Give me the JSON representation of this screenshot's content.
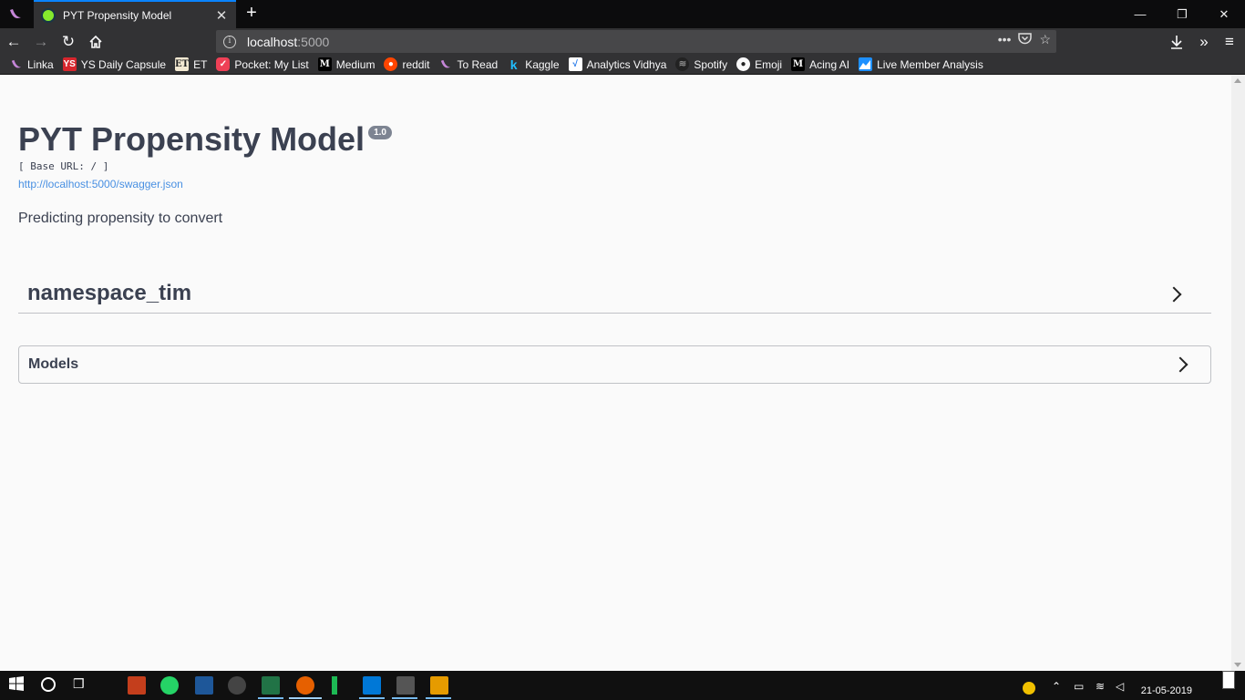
{
  "browser": {
    "tab": {
      "title": "PYT Propensity Model"
    },
    "url": {
      "host": "localhost",
      "port": ":5000"
    },
    "bookmarks": [
      {
        "label": "Linka",
        "icon": "linka-icon"
      },
      {
        "label": "YS Daily Capsule",
        "icon": "ys-icon"
      },
      {
        "label": "ET",
        "icon": "et-icon"
      },
      {
        "label": "Pocket: My List",
        "icon": "pocket-icon"
      },
      {
        "label": "Medium",
        "icon": "medium-icon"
      },
      {
        "label": "reddit",
        "icon": "reddit-icon"
      },
      {
        "label": "To Read",
        "icon": "linka-icon"
      },
      {
        "label": "Kaggle",
        "icon": "kaggle-icon"
      },
      {
        "label": "Analytics Vidhya",
        "icon": "analytics-icon"
      },
      {
        "label": "Spotify",
        "icon": "spotify-icon"
      },
      {
        "label": "Emoji",
        "icon": "github-icon"
      },
      {
        "label": "Acing AI",
        "icon": "medium-icon"
      },
      {
        "label": "Live Member Analysis",
        "icon": "chart-icon"
      }
    ]
  },
  "swagger": {
    "title": "PYT Propensity Model",
    "version": "1.0",
    "base_url": "[ Base URL: / ]",
    "spec_link": "http://localhost:5000/swagger.json",
    "description": "Predicting propensity to convert",
    "namespace": "namespace_tim",
    "models_label": "Models"
  },
  "taskbar": {
    "date": "21-05-2019"
  },
  "colors": {
    "title_text": "#3b4151",
    "link": "#4990e2",
    "version_badge": "#7d8492",
    "tab_accent": "#0a84ff"
  }
}
